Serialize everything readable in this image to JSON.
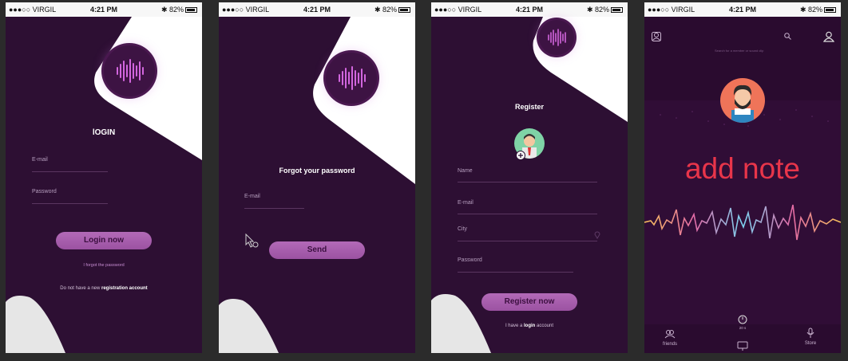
{
  "status_bar": {
    "carrier": "●●●○○ VIRGIL",
    "time": "4:21 PM",
    "battery": "82%"
  },
  "login": {
    "title": "lOGIN",
    "email_label": "E-mail",
    "password_label": "Password",
    "button": "Login now",
    "forgot_link": "I forgot the password",
    "signup_prefix": "Do not have a new ",
    "signup_link": "registration account"
  },
  "forgot": {
    "title": "Forgot your password",
    "email_label": "E-mail",
    "button": "Send"
  },
  "register": {
    "title": "Register",
    "name_label": "Name",
    "email_label": "E-mail",
    "city_label": "City",
    "password_label": "Password",
    "button": "Register now",
    "login_prefix": "I have a ",
    "login_link": "login",
    "login_suffix": " account"
  },
  "home": {
    "search_placeholder": "Search for a member or sound clip",
    "note_text": "add note",
    "timer": "20 s",
    "tab_friends": "friends",
    "tab_store": "Store"
  },
  "colors": {
    "bg": "#2d0f33",
    "accent": "#a95fb0",
    "note": "#e8354a"
  }
}
